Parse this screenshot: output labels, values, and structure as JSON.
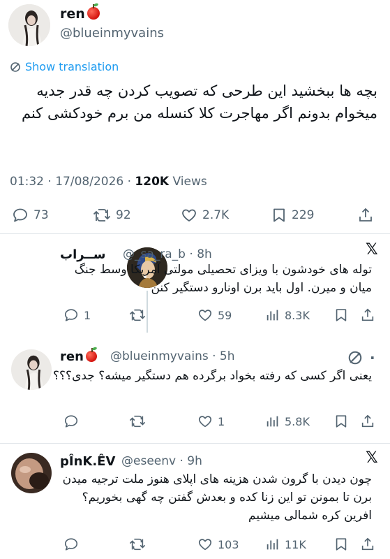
{
  "main_tweet": {
    "display_name": "ren",
    "handle": "@blueinmyvains",
    "show_translation": "Show translation",
    "text": "بچه ها ببخشید این طرحی که تصویب کردن چه قدر جدیه میخوام بدونم اگر مهاجرت کلا کنسله من برم خودکشی کنم",
    "time": "01:32",
    "date": "17/08/2026",
    "views_count": "120K",
    "views_label": "Views",
    "replies": "73",
    "reposts": "92",
    "likes": "2.7K",
    "bookmarks": "229"
  },
  "replies": [
    {
      "display_name": "ســراب",
      "handle": "@_sa_ra_b",
      "time": "8h",
      "text": "توله های خودشون با ویزای تحصیلی مولتی آمریکا وسط جنگ میان و میرن. اول باید برن اونارو دستگیر کنن",
      "replies": "1",
      "reposts": "",
      "likes": "59",
      "views": "8.3K"
    },
    {
      "display_name": "ren",
      "handle": "@blueinmyvains",
      "time": "5h",
      "text": "یعنی اگر کسی که رفته بخواد برگرده هم دستگیر میشه؟ جدی؟؟؟",
      "replies": "",
      "reposts": "",
      "likes": "1",
      "views": "5.8K"
    },
    {
      "display_name": "pÎnK.ÊV",
      "handle": "@eseenv",
      "time": "9h",
      "text": "چون دیدن با گرون شدن هزینه های اپلای هنوز ملت ترجیه میدن برن تا بمونن تو این زنا کده و بعدش گفتن چه گهی بخوریم؟ افرین کره شمالی میشیم",
      "replies": "",
      "reposts": "",
      "likes": "103",
      "views": "11K"
    }
  ],
  "icons": {
    "reply": "reply-icon",
    "repost": "repost-icon",
    "like": "heart-icon",
    "bookmark": "bookmark-icon",
    "share": "share-icon",
    "views": "views-icon",
    "translate": "translate-icon",
    "x_logo": "x-logo-icon",
    "apple": "red-apple-emoji"
  },
  "colors": {
    "link": "#1d9bf0",
    "secondary_text": "#536471",
    "primary_text": "#0f1419",
    "divider": "#e1e6ea"
  }
}
